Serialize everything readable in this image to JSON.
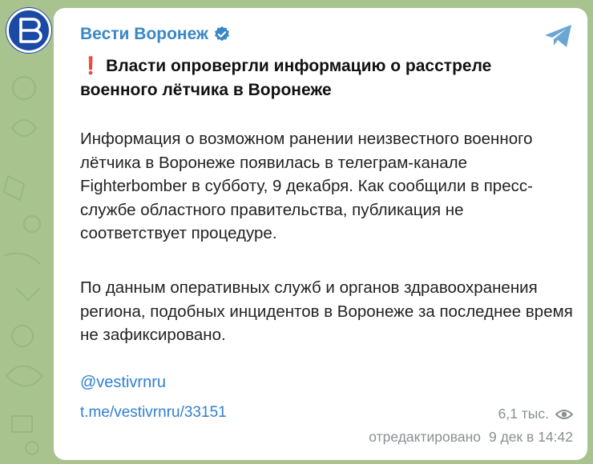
{
  "channel": {
    "name": "Вести Воронеж",
    "avatar_letter": "В",
    "verified_icon": "verified-badge-icon",
    "share_icon": "telegram-share-icon"
  },
  "post": {
    "alert_icon": "❗",
    "headline": "Власти опровергли информацию о расстреле военного лётчика в Воронеже",
    "paragraph1": "Информация о возможном ранении неизвестного военного лётчика в Воронеже появилась в телеграм-канале Fighterbomber в субботу, 9 декабря. Как сообщили в пресс-службе областного правительства, публикация не соответствует процедуре.",
    "paragraph2": "По данным оперативных служб и органов здравоохранения региона, подобных инцидентов в Воронеже за последнее время не зафиксировано.",
    "mention": "@vestivrnru",
    "link": "t.me/vestivrnru/33151"
  },
  "footer": {
    "views": "6,1 тыс.",
    "edited_label": "отредактировано",
    "timestamp": "9 дек в 14:42"
  },
  "colors": {
    "background": "#a9c38f",
    "accent": "#3a87c7",
    "link": "#2f7fd0",
    "meta": "#8a8f94",
    "alert": "#d61f2b"
  }
}
